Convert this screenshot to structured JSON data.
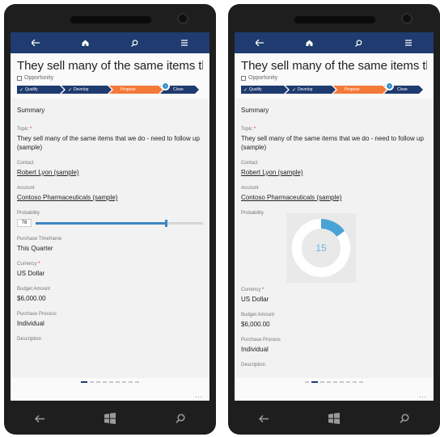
{
  "phones": [
    {
      "title": "They sell many of the same items th...",
      "entity_type": "Opportunity",
      "stages": [
        "Qualify",
        "Develop",
        "Propose",
        "Close"
      ],
      "section_title": "Summary",
      "topic_label": "Topic",
      "topic_value": "They sell many of the same items that we do - need to follow up (sample)",
      "contact_label": "Contact",
      "contact_value": "Robert Lyon (sample)",
      "account_label": "Account",
      "account_value": "Contoso Pharmaceuticals (sample)",
      "probability_label": "Probability",
      "probability_value": "78",
      "probability_fraction": 0.78,
      "timeframe_label": "Purchase Timeframe",
      "timeframe_value": "This Quarter",
      "currency_label": "Currency",
      "currency_value": "US Dollar",
      "budget_label": "Budget Amount",
      "budget_value": "$6,000.00",
      "process_label": "Purchase Process",
      "process_value": "Individual",
      "description_label": "Description",
      "more": "..."
    },
    {
      "title": "They sell many of the same items th...",
      "entity_type": "Opportunity",
      "stages": [
        "Qualify",
        "Develop",
        "Propose",
        "Close"
      ],
      "section_title": "Summary",
      "topic_label": "Topic",
      "topic_value": "They sell many of the same items that we do - need to follow up (sample)",
      "contact_label": "Contact",
      "contact_value": "Robert Lyon (sample)",
      "account_label": "Account",
      "account_value": "Contoso Pharmaceuticals (sample)",
      "probability_label": "Probability",
      "probability_value": "15",
      "probability_fraction": 0.15,
      "currency_label": "Currency",
      "currency_value": "US Dollar",
      "budget_label": "Budget Amount",
      "budget_value": "$6,000.00",
      "process_label": "Purchase Process",
      "process_value": "Individual",
      "description_label": "Description",
      "more": "..."
    }
  ],
  "icons": {
    "nav": [
      "back-arrow-icon",
      "home-icon",
      "search-icon",
      "menu-icon"
    ],
    "hardware": [
      "back-icon",
      "windows-start-icon",
      "search-icon"
    ]
  },
  "colors": {
    "navbar": "#1f3b6f",
    "active_stage": "#f47a3a",
    "accent_blue": "#3a87c4",
    "donut_fill": "#4aa3d4",
    "required": "#d9261c"
  }
}
